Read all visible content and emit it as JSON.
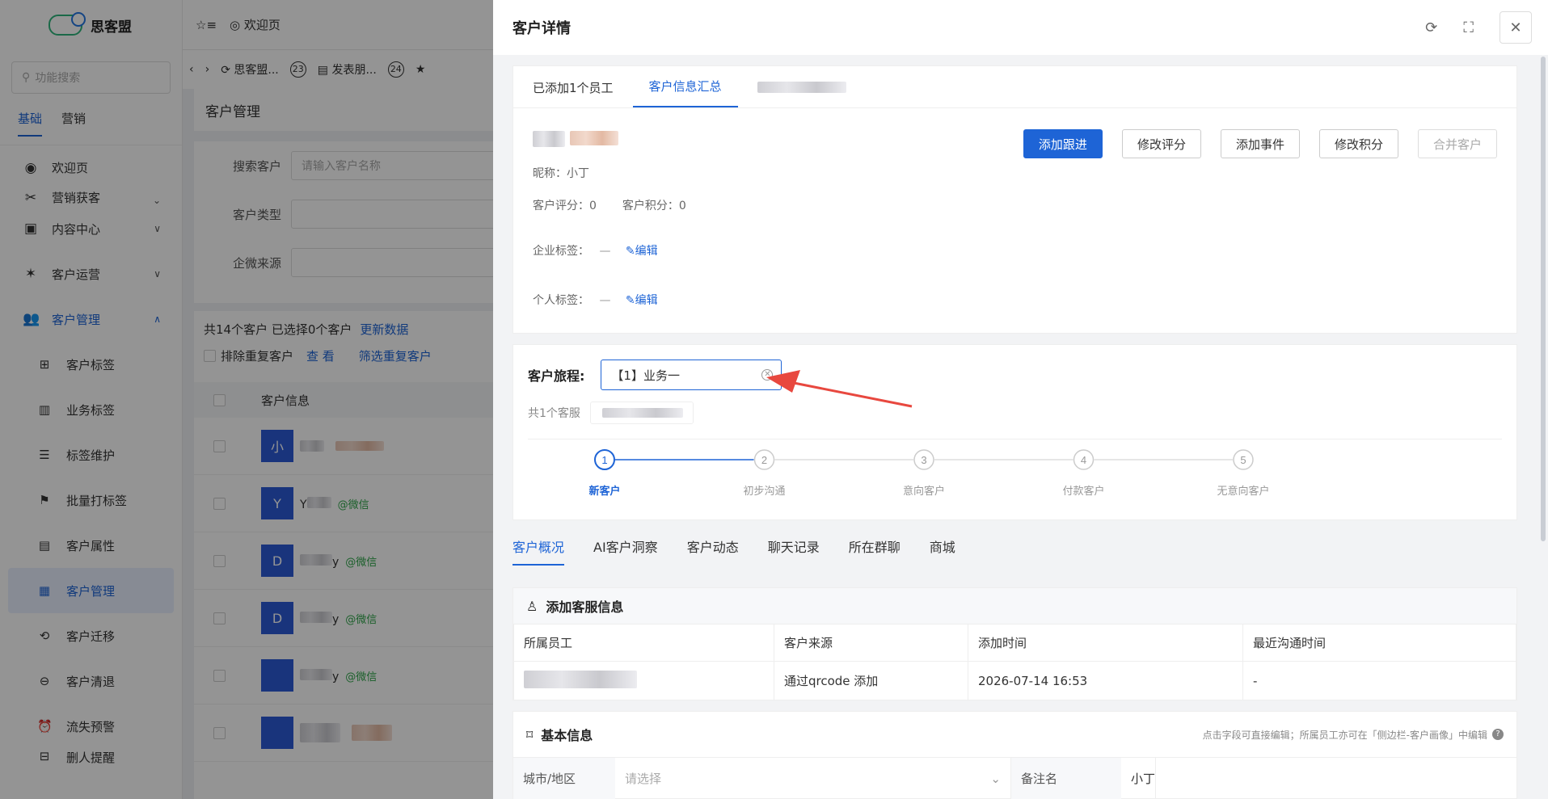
{
  "sidebar": {
    "brand": "思客盟",
    "search_placeholder": "功能搜索",
    "tabs": [
      "基础",
      "营销"
    ],
    "items": {
      "welcome": "欢迎页",
      "marketing": "营销获客",
      "content": "内容中心",
      "ops": "客户运营",
      "customer_mgmt": "客户管理"
    },
    "subitems": [
      "客户标签",
      "业务标签",
      "标签维护",
      "批量打标签",
      "客户属性",
      "客户管理",
      "客户迁移",
      "客户清退",
      "流失预警",
      "删人提醒"
    ]
  },
  "topbar": {
    "welcome": "欢迎页"
  },
  "tabsbar": {
    "tab1": "思客盟...",
    "badge1": "23",
    "tab2": "发表朋...",
    "badge2": "24"
  },
  "page": {
    "title": "客户管理",
    "filter_customer": "搜索客户",
    "filter_customer_placeholder": "请输入客户名称",
    "filter_type": "客户类型",
    "filter_source": "企微来源",
    "summary": "共14个客户 已选择0个客户",
    "refresh": "更新数据",
    "exclude_dup": "排除重复客户",
    "view": "查 看",
    "filter_dup": "筛选重复客户",
    "col_info": "客户信息",
    "rows": [
      {
        "avatar": "小",
        "tag": ""
      },
      {
        "avatar": "Y",
        "prefix": "Y",
        "tag": "@微信"
      },
      {
        "avatar": "D",
        "suffix": "y",
        "tag": "@微信"
      },
      {
        "avatar": "D",
        "suffix": "y",
        "tag": "@微信"
      },
      {
        "avatar": "",
        "suffix": "y",
        "tag": "@微信"
      },
      {
        "avatar": "",
        "tag": ""
      }
    ]
  },
  "drawer": {
    "title": "客户详情",
    "tabs": [
      "已添加1个员工",
      "客户信息汇总"
    ],
    "actions": [
      "添加跟进",
      "修改评分",
      "添加事件",
      "修改积分",
      "合并客户"
    ],
    "nickname": "昵称：小丁",
    "score": "客户评分：0",
    "points": "客户积分：0",
    "corp_tag_label": "企业标签：",
    "personal_tag_label": "个人标签：",
    "dash": "—",
    "edit": "编辑",
    "journey_label": "客户旅程:",
    "journey_value": "【1】业务一",
    "service_count": "共1个客服",
    "steps": [
      {
        "n": "1",
        "label": "新客户"
      },
      {
        "n": "2",
        "label": "初步沟通"
      },
      {
        "n": "3",
        "label": "意向客户"
      },
      {
        "n": "4",
        "label": "付款客户"
      },
      {
        "n": "5",
        "label": "无意向客户"
      }
    ],
    "current_step": 1,
    "bottom_tabs": [
      "客户概况",
      "AI客户洞察",
      "客户动态",
      "聊天记录",
      "所在群聊",
      "商城"
    ],
    "service_section": "添加客服信息",
    "table_headers": [
      "所属员工",
      "客户来源",
      "添加时间",
      "最近沟通时间"
    ],
    "table_row": {
      "source": "通过qrcode 添加",
      "time": "2026-07-14 16:53",
      "last": "-"
    },
    "basic_section": "基本信息",
    "basic_hint": "点击字段可直接编辑；所属员工亦可在「侧边栏-客户画像」中编辑",
    "city_label": "城市/地区",
    "city_placeholder": "请选择",
    "remark_label": "备注名",
    "remark_value": "小丁"
  },
  "colors": {
    "accent": "#1e64d6",
    "arrow": "#e8483f"
  }
}
